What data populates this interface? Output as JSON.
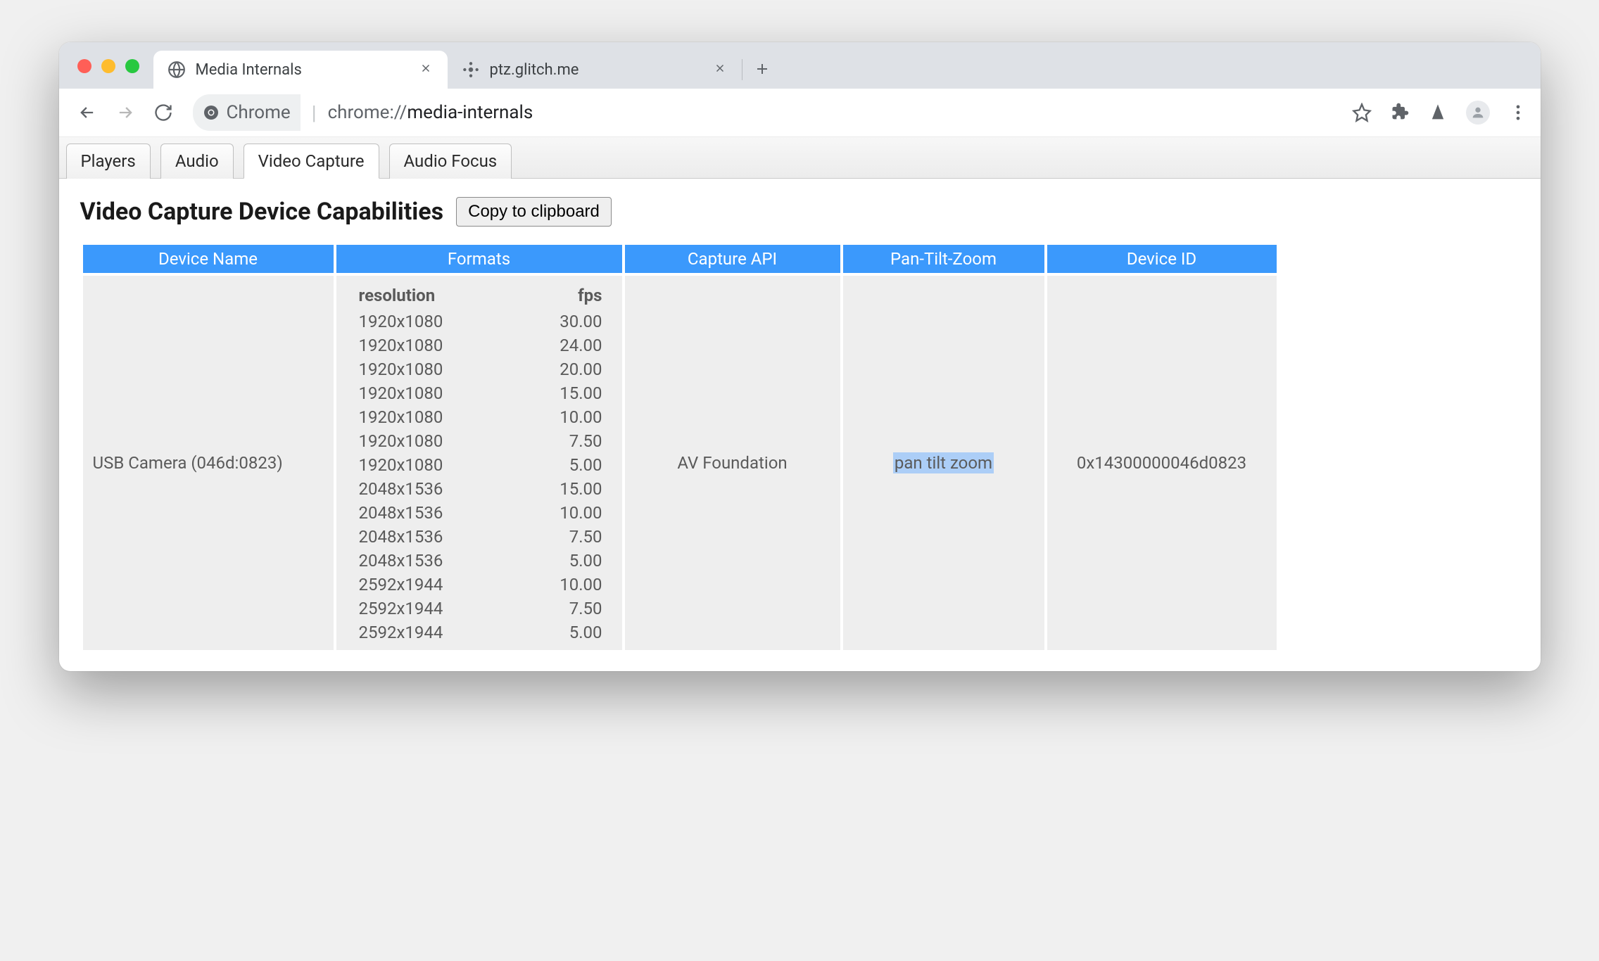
{
  "browser_tabs": [
    {
      "title": "Media Internals",
      "active": true
    },
    {
      "title": "ptz.glitch.me",
      "active": false
    }
  ],
  "address_bar": {
    "chip_label": "Chrome",
    "url_grey_prefix": "chrome://",
    "url_dark": "media-internals"
  },
  "internal_tabs": {
    "players": "Players",
    "audio": "Audio",
    "video_capture": "Video Capture",
    "audio_focus": "Audio Focus"
  },
  "heading": "Video Capture Device Capabilities",
  "copy_button": "Copy to clipboard",
  "table_headers": {
    "device_name": "Device Name",
    "formats": "Formats",
    "capture_api": "Capture API",
    "ptz": "Pan-Tilt-Zoom",
    "device_id": "Device ID"
  },
  "format_headers": {
    "resolution": "resolution",
    "fps": "fps"
  },
  "device": {
    "name": "USB Camera (046d:0823)",
    "capture_api": "AV Foundation",
    "ptz": "pan tilt zoom",
    "id": "0x14300000046d0823",
    "formats": [
      {
        "res": "1920x1080",
        "fps": "30.00"
      },
      {
        "res": "1920x1080",
        "fps": "24.00"
      },
      {
        "res": "1920x1080",
        "fps": "20.00"
      },
      {
        "res": "1920x1080",
        "fps": "15.00"
      },
      {
        "res": "1920x1080",
        "fps": "10.00"
      },
      {
        "res": "1920x1080",
        "fps": "7.50"
      },
      {
        "res": "1920x1080",
        "fps": "5.00"
      },
      {
        "res": "2048x1536",
        "fps": "15.00"
      },
      {
        "res": "2048x1536",
        "fps": "10.00"
      },
      {
        "res": "2048x1536",
        "fps": "7.50"
      },
      {
        "res": "2048x1536",
        "fps": "5.00"
      },
      {
        "res": "2592x1944",
        "fps": "10.00"
      },
      {
        "res": "2592x1944",
        "fps": "7.50"
      },
      {
        "res": "2592x1944",
        "fps": "5.00"
      }
    ]
  }
}
